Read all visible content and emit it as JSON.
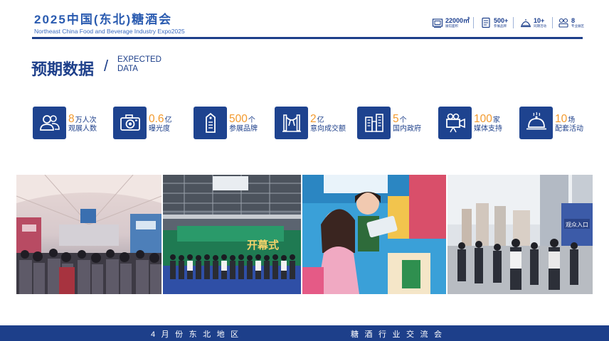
{
  "header": {
    "title": "2025中国(东北)糖酒会",
    "subtitle": "Northeast China Food and Beverage Industry Expo2025",
    "stats": [
      {
        "number": "22000㎡",
        "label": "展馆面积",
        "icon": "exhibition-hall-icon"
      },
      {
        "number": "500+",
        "label": "参展品牌",
        "icon": "brand-tag-icon"
      },
      {
        "number": "10+",
        "label": "同期活动",
        "icon": "event-cloche-icon"
      },
      {
        "number": "8",
        "label": "专业展区",
        "icon": "zones-icon"
      }
    ]
  },
  "section": {
    "title": "预期数据",
    "slash": "/",
    "english_line1": "EXPECTED",
    "english_line2": "DATA"
  },
  "metrics": [
    {
      "value": "8",
      "unit": "万人次",
      "label": "观展人数",
      "icon": "visitors-icon"
    },
    {
      "value": "0.6",
      "unit": "亿",
      "label": "曝光度",
      "icon": "camera-icon"
    },
    {
      "value": "500",
      "unit": "个",
      "label": "参展品牌",
      "icon": "price-tag-icon"
    },
    {
      "value": "2",
      "unit": "亿",
      "label": "意向成交额",
      "icon": "ribbon-cutting-icon"
    },
    {
      "value": "5",
      "unit": "个",
      "label": "国内政府",
      "icon": "government-building-icon"
    },
    {
      "value": "100",
      "unit": "家",
      "label": "媒体支持",
      "icon": "video-camera-icon"
    },
    {
      "value": "10",
      "unit": "场",
      "label": "配套活动",
      "icon": "food-cloche-icon"
    }
  ],
  "photos": [
    {
      "name": "exhibition-hall-crowd-photo",
      "banner_text": ""
    },
    {
      "name": "opening-ceremony-stage-photo",
      "banner_text": "开幕式"
    },
    {
      "name": "livestream-host-photo",
      "banner_text": ""
    },
    {
      "name": "outdoor-entrance-photo",
      "banner_text": "观众入口"
    }
  ],
  "footer": {
    "left": "4月份东北地区",
    "right": "糖酒行业交流会"
  },
  "colors": {
    "primary": "#1d3f8a",
    "accent": "#f29a2e",
    "background": "#ffffff"
  }
}
